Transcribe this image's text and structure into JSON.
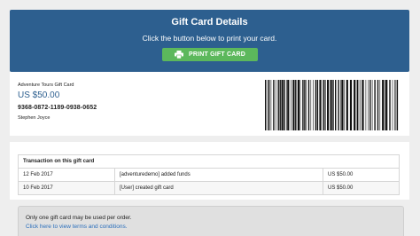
{
  "header": {
    "title": "Gift Card Details",
    "subtitle": "Click the button below to print your card.",
    "print_button_label": "PRINT GIFT CARD"
  },
  "gift_card": {
    "name": "Adventure Tours Gift Card",
    "amount": "US $50.00",
    "number": "9368-0872-1189-0938-0652",
    "holder": "Stephen Joyce"
  },
  "transactions": {
    "heading": "Transaction on this gift card",
    "rows": [
      {
        "date": "12 Feb 2017",
        "description": "[adventuredemo] added funds",
        "amount": "US $50.00"
      },
      {
        "date": "10 Feb 2017",
        "description": "[User] created gift card",
        "amount": "US $50.00"
      }
    ]
  },
  "notice": {
    "text": "Only one gift card may be used per order.",
    "link": "Click here to view terms and conditions."
  }
}
